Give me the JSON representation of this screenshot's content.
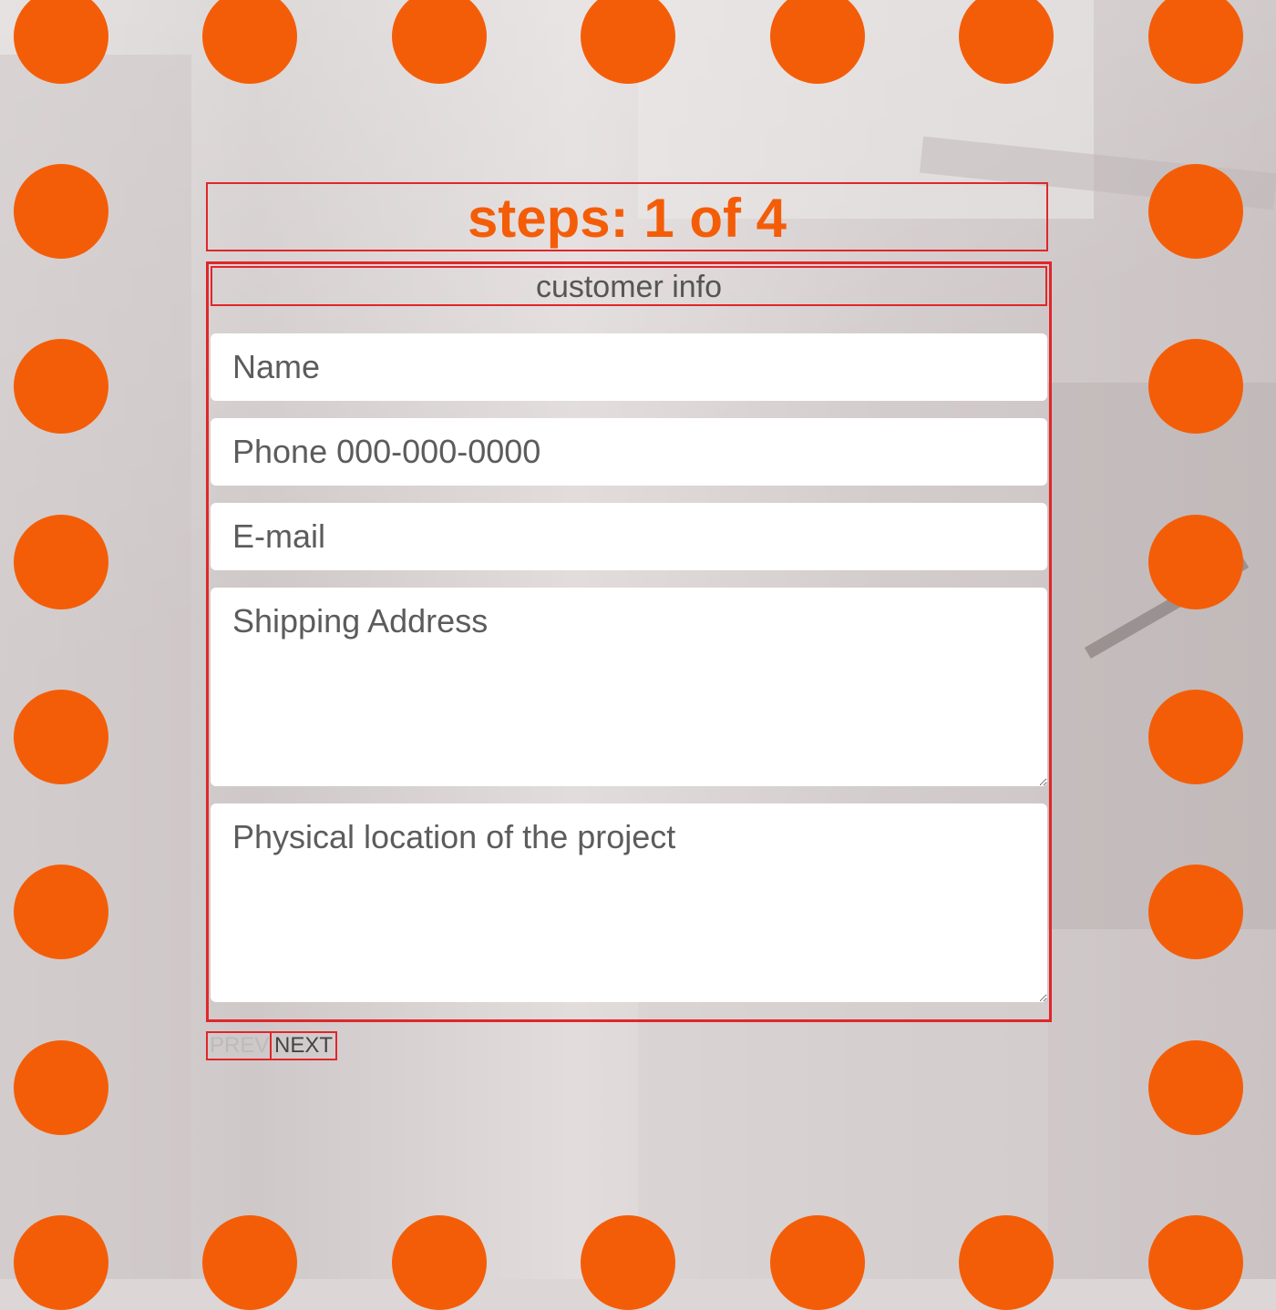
{
  "header": {
    "steps_title": "steps: 1 of 4"
  },
  "form": {
    "legend": "customer info",
    "fields": {
      "name_placeholder": "Name",
      "phone_placeholder": "Phone 000-000-0000",
      "email_placeholder": "E-mail",
      "shipping_placeholder": "Shipping Address",
      "location_placeholder": "Physical location of the project"
    }
  },
  "navigation": {
    "prev_label": "PREV",
    "next_label": "NEXT"
  },
  "colors": {
    "accent_orange": "#f45d08",
    "border_red": "#e0262b"
  },
  "decor": {
    "dot_shape": "orange-circle"
  }
}
